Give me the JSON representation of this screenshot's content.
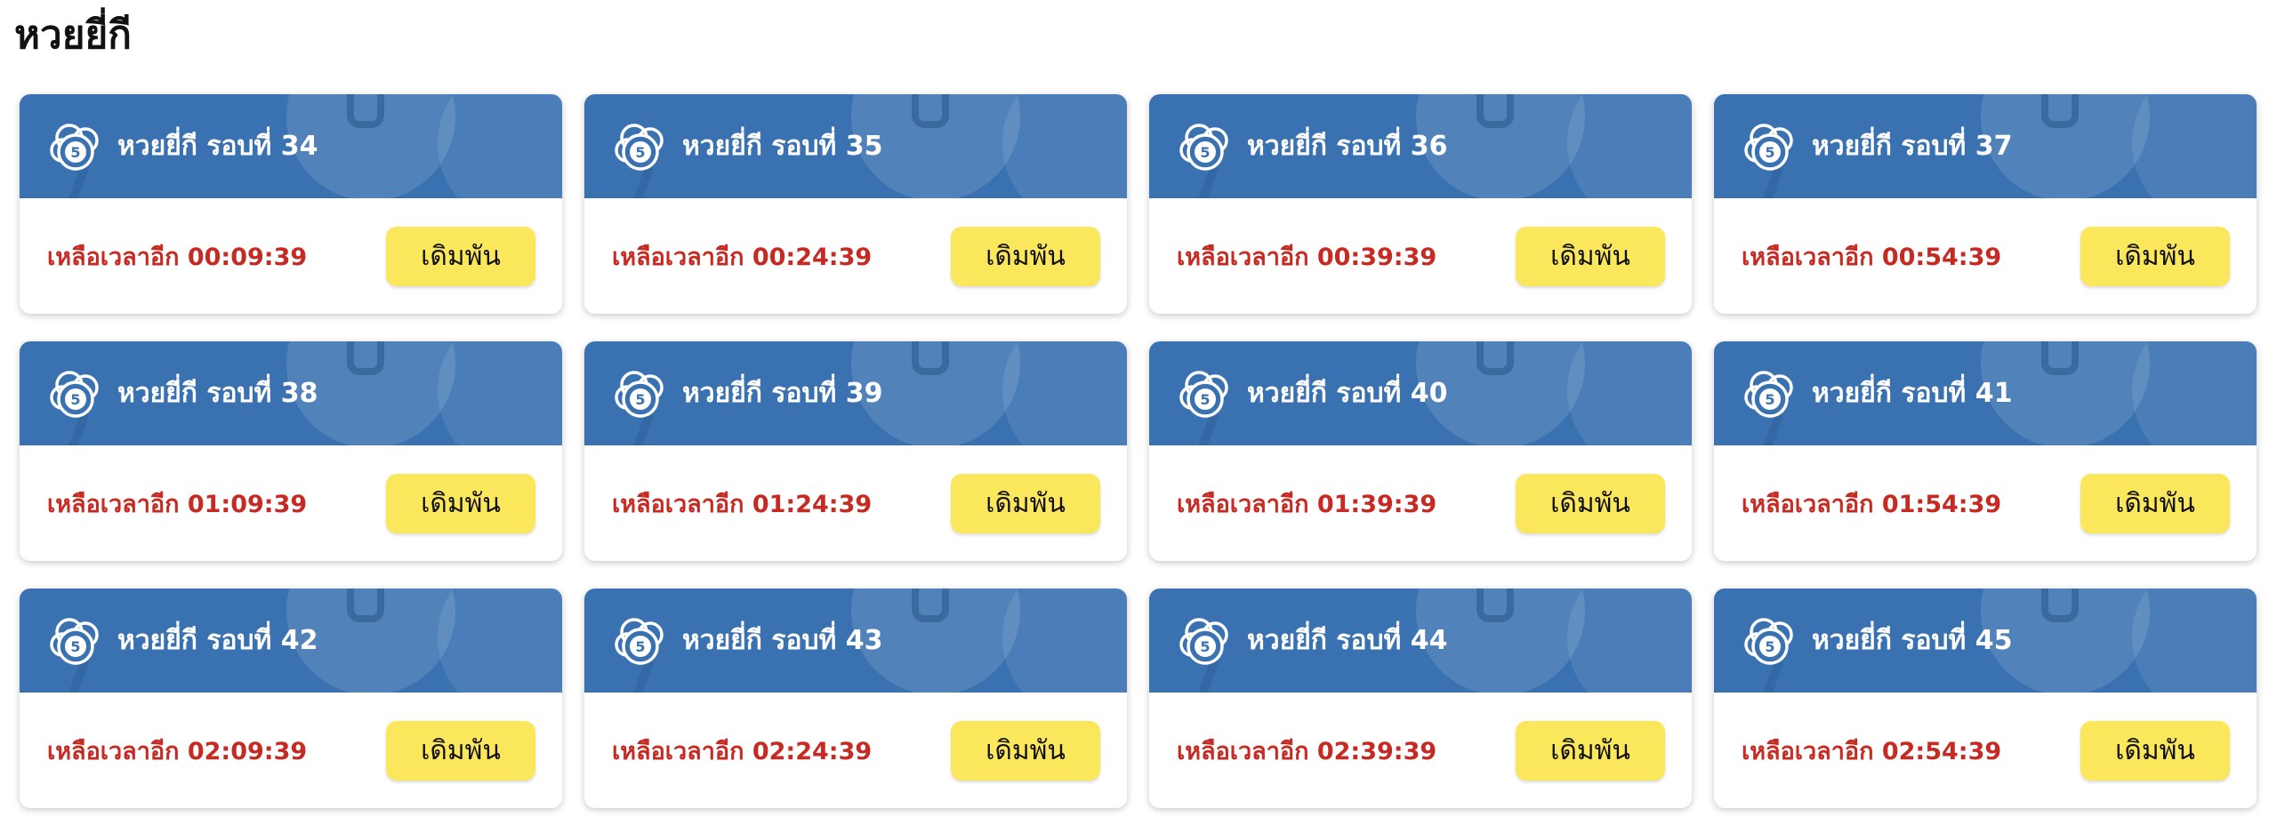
{
  "page": {
    "title": "หวยยี่กี"
  },
  "colors": {
    "header_blue": "#3a72b1",
    "countdown_red": "#c62a22",
    "button_yellow": "#fbe75b"
  },
  "icons": {
    "card_logo": "lottery-ball-5-icon"
  },
  "cards": [
    {
      "title": "หวยยี่กี รอบที่ 34",
      "countdown": "เหลือเวลาอีก 00:09:39",
      "button": "เดิมพัน"
    },
    {
      "title": "หวยยี่กี รอบที่ 35",
      "countdown": "เหลือเวลาอีก 00:24:39",
      "button": "เดิมพัน"
    },
    {
      "title": "หวยยี่กี รอบที่ 36",
      "countdown": "เหลือเวลาอีก 00:39:39",
      "button": "เดิมพัน"
    },
    {
      "title": "หวยยี่กี รอบที่ 37",
      "countdown": "เหลือเวลาอีก 00:54:39",
      "button": "เดิมพัน"
    },
    {
      "title": "หวยยี่กี รอบที่ 38",
      "countdown": "เหลือเวลาอีก 01:09:39",
      "button": "เดิมพัน"
    },
    {
      "title": "หวยยี่กี รอบที่ 39",
      "countdown": "เหลือเวลาอีก 01:24:39",
      "button": "เดิมพัน"
    },
    {
      "title": "หวยยี่กี รอบที่ 40",
      "countdown": "เหลือเวลาอีก 01:39:39",
      "button": "เดิมพัน"
    },
    {
      "title": "หวยยี่กี รอบที่ 41",
      "countdown": "เหลือเวลาอีก 01:54:39",
      "button": "เดิมพัน"
    },
    {
      "title": "หวยยี่กี รอบที่ 42",
      "countdown": "เหลือเวลาอีก 02:09:39",
      "button": "เดิมพัน"
    },
    {
      "title": "หวยยี่กี รอบที่ 43",
      "countdown": "เหลือเวลาอีก 02:24:39",
      "button": "เดิมพัน"
    },
    {
      "title": "หวยยี่กี รอบที่ 44",
      "countdown": "เหลือเวลาอีก 02:39:39",
      "button": "เดิมพัน"
    },
    {
      "title": "หวยยี่กี รอบที่ 45",
      "countdown": "เหลือเวลาอีก 02:54:39",
      "button": "เดิมพัน"
    }
  ]
}
